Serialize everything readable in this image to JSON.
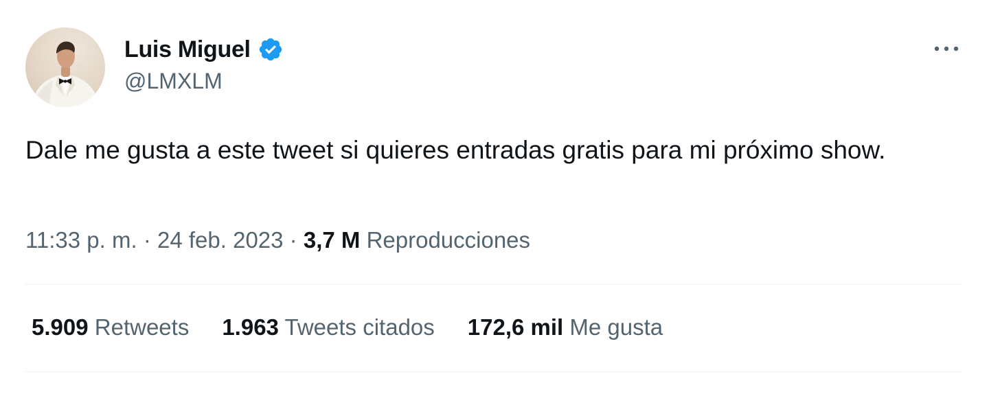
{
  "tweet": {
    "author": {
      "display_name": "Luis Miguel",
      "handle": "@LMXLM",
      "verified": true,
      "verified_color": "#1d9bf0"
    },
    "more_icon": "more-horizontal-icon",
    "text": "Dale me gusta a este tweet si quieres entradas gratis para mi próximo show.",
    "time": "11:33 p. m.",
    "date": "24 feb. 2023",
    "separator": "·",
    "views_count": "3,7 M",
    "views_label": "Reproducciones",
    "stats": {
      "retweets_count": "5.909",
      "retweets_label": "Retweets",
      "quotes_count": "1.963",
      "quotes_label": "Tweets citados",
      "likes_count": "172,6 mil",
      "likes_label": "Me gusta"
    }
  },
  "colors": {
    "text_primary": "#0f1419",
    "text_secondary": "#536471",
    "divider": "#eff3f4",
    "verified": "#1d9bf0"
  }
}
